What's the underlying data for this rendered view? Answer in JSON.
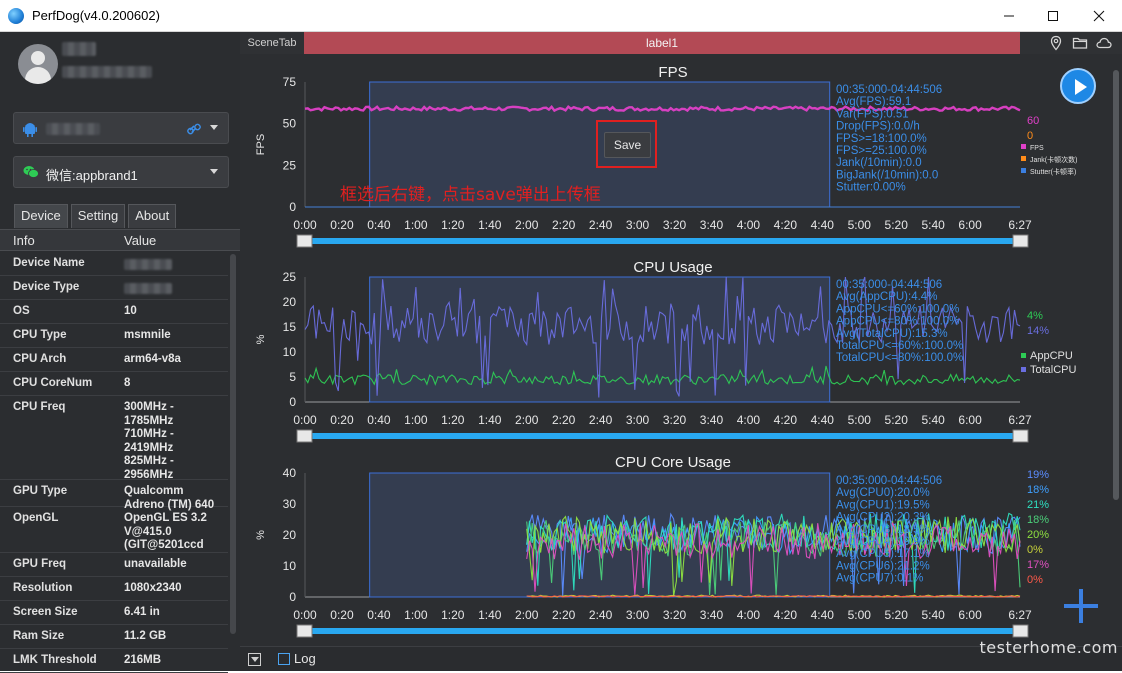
{
  "window": {
    "title": "PerfDog(v4.0.200602)",
    "controls": [
      "minimize-icon",
      "maximize-icon",
      "close-icon"
    ]
  },
  "sidebar": {
    "device_select": {
      "icon": "android-icon",
      "value": ""
    },
    "app_select": {
      "icon": "wechat-icon",
      "value": "微信:appbrand1"
    },
    "tabs": [
      "Device",
      "Setting",
      "About"
    ],
    "active_tab": "Device",
    "table_headers": {
      "key": "Info",
      "value": "Value"
    },
    "rows": [
      {
        "key": "Device Name",
        "value": "",
        "blurred": true
      },
      {
        "key": "Device Type",
        "value": "",
        "blurred": true
      },
      {
        "key": "OS",
        "value": "10"
      },
      {
        "key": "CPU Type",
        "value": "msmnile"
      },
      {
        "key": "CPU Arch",
        "value": "arm64-v8a"
      },
      {
        "key": "CPU CoreNum",
        "value": "8"
      },
      {
        "key": "CPU Freq",
        "value": "300MHz -\n1785MHz\n710MHz -\n2419MHz\n825MHz -\n2956MHz"
      },
      {
        "key": "GPU Type",
        "value": "Qualcomm\nAdreno (TM) 640"
      },
      {
        "key": "OpenGL",
        "value": "OpenGL ES 3.2\nV@415.0\n(GIT@5201ccd"
      },
      {
        "key": "GPU Freq",
        "value": "unavailable"
      },
      {
        "key": "Resolution",
        "value": "1080x2340"
      },
      {
        "key": "Screen Size",
        "value": "6.41 in"
      },
      {
        "key": "Ram Size",
        "value": "11.2 GB"
      },
      {
        "key": "LMK Threshold",
        "value": "216MB"
      }
    ]
  },
  "scene": {
    "tab_label": "SceneTab",
    "label": "label1",
    "icons": [
      "location-icon",
      "folder-icon",
      "cloud-icon"
    ]
  },
  "annotation": {
    "save_button": "Save",
    "note": "框选后右键，点击save弹出上传框"
  },
  "chart_data": [
    {
      "type": "line",
      "title": "FPS",
      "ylabel": "FPS",
      "ylim": [
        0,
        75
      ],
      "yticks": [
        "75",
        "50",
        "25",
        "0"
      ],
      "xticks": [
        "0:00",
        "0:20",
        "0:40",
        "1:00",
        "1:20",
        "1:40",
        "2:00",
        "2:20",
        "2:40",
        "3:00",
        "3:20",
        "3:40",
        "4:00",
        "4:20",
        "4:40",
        "5:00",
        "5:20",
        "5:40",
        "6:00",
        "6:27"
      ],
      "selection": {
        "from": "0:35",
        "to": "4:44"
      },
      "stats": [
        "00:35:000-04:44:506",
        "Avg(FPS):59.1",
        "Var(FPS):0.51",
        "Drop(FPS):0.0/h",
        "FPS>=18:100.0%",
        "FPS>=25:100.0%",
        "Jank(/10min):0.0",
        "BigJank(/10min):0.0",
        "Stutter:0.00%"
      ],
      "current_values": [
        {
          "value": "60",
          "color": "#e040c8"
        },
        {
          "value": "0",
          "color": "#ff8c1a"
        }
      ],
      "series": [
        {
          "name": "FPS",
          "color": "#e040c8",
          "mean": 59,
          "jitter": 1.2,
          "start": 0
        },
        {
          "name": "Jank(卡顿次数)",
          "color": "#ff8c1a",
          "mean": 0,
          "jitter": 0,
          "start": 0
        },
        {
          "name": "Stutter(卡顿率)",
          "color": "#3b7fe0",
          "mean": 0,
          "jitter": 0,
          "start": 0
        }
      ]
    },
    {
      "type": "line",
      "title": "CPU Usage",
      "ylabel": "%",
      "ylim": [
        0,
        25
      ],
      "yticks": [
        "25",
        "20",
        "15",
        "10",
        "5",
        "0"
      ],
      "xticks": [
        "0:00",
        "0:20",
        "0:40",
        "1:00",
        "1:20",
        "1:40",
        "2:00",
        "2:20",
        "2:40",
        "3:00",
        "3:20",
        "3:40",
        "4:00",
        "4:20",
        "4:40",
        "5:00",
        "5:20",
        "5:40",
        "6:00",
        "6:27"
      ],
      "selection": {
        "from": "0:35",
        "to": "4:44"
      },
      "stats": [
        "00:35:000-04:44:506",
        "Avg(AppCPU):4.4%",
        "AppCPU<=60%:100.0%",
        "AppCPU<=80%:100.0%",
        "Avg(TotalCPU):15.3%",
        "TotalCPU<=60%:100.0%",
        "TotalCPU<=80%:100.0%"
      ],
      "current_values": [
        {
          "value": "4%",
          "color": "#2ecc55"
        },
        {
          "value": "14%",
          "color": "#6a6ee0"
        }
      ],
      "series": [
        {
          "name": "AppCPU",
          "color": "#2ecc55",
          "mean": 4.5,
          "jitter": 1.0,
          "start": 0
        },
        {
          "name": "TotalCPU",
          "color": "#6a6ee0",
          "mean": 15.5,
          "jitter": 4.0,
          "start": 0
        }
      ]
    },
    {
      "type": "line",
      "title": "CPU Core Usage",
      "ylabel": "%",
      "ylim": [
        0,
        40
      ],
      "yticks": [
        "40",
        "30",
        "20",
        "10",
        "0"
      ],
      "xticks": [
        "0:00",
        "0:20",
        "0:40",
        "1:00",
        "1:20",
        "1:40",
        "2:00",
        "2:20",
        "2:40",
        "3:00",
        "3:20",
        "3:40",
        "4:00",
        "4:20",
        "4:40",
        "5:00",
        "5:20",
        "5:40",
        "6:00",
        "6:27"
      ],
      "selection": {
        "from": "0:35",
        "to": "4:44"
      },
      "stats": [
        "00:35:000-04:44:506",
        "Avg(CPU0):20.0%",
        "Avg(CPU1):19.5%",
        "Avg(CPU2):20.3%",
        "Avg(CPU3):18.5%",
        "Avg(CPU4):19.9%",
        "Avg(CPU5):17.1%",
        "Avg(CPU6):21.2%",
        "Avg(CPU7):0.1%"
      ],
      "current_values": [
        {
          "value": "19%",
          "color": "#5b8cff"
        },
        {
          "value": "18%",
          "color": "#3fa0ff"
        },
        {
          "value": "21%",
          "color": "#2ee0c0"
        },
        {
          "value": "18%",
          "color": "#4cd07a"
        },
        {
          "value": "20%",
          "color": "#8ee040"
        },
        {
          "value": "0%",
          "color": "#c8d23a"
        },
        {
          "value": "17%",
          "color": "#e050c0"
        },
        {
          "value": "0%",
          "color": "#ff5a4a"
        }
      ],
      "series": [
        {
          "name": "CPU0",
          "color": "#5b8cff",
          "mean": 21,
          "jitter": 6,
          "start": 2.0
        },
        {
          "name": "CPU1",
          "color": "#3fa0ff",
          "mean": 20,
          "jitter": 6,
          "start": 2.0
        },
        {
          "name": "CPU2",
          "color": "#2ee0c0",
          "mean": 21,
          "jitter": 6,
          "start": 2.0
        },
        {
          "name": "CPU3",
          "color": "#4cd07a",
          "mean": 19,
          "jitter": 6,
          "start": 2.0
        },
        {
          "name": "CPU4",
          "color": "#8ee040",
          "mean": 20,
          "jitter": 6,
          "start": 2.0
        },
        {
          "name": "CPU5",
          "color": "#c8d23a",
          "mean": 0.3,
          "jitter": 0.3,
          "start": 2.0
        },
        {
          "name": "CPU6",
          "color": "#e050c0",
          "mean": 18,
          "jitter": 6,
          "start": 2.0
        },
        {
          "name": "CPU7",
          "color": "#ff5a4a",
          "mean": 0.2,
          "jitter": 0.2,
          "start": 2.0
        }
      ]
    }
  ],
  "bottom": {
    "log_label": "Log",
    "watermark": "testerhome.com"
  }
}
